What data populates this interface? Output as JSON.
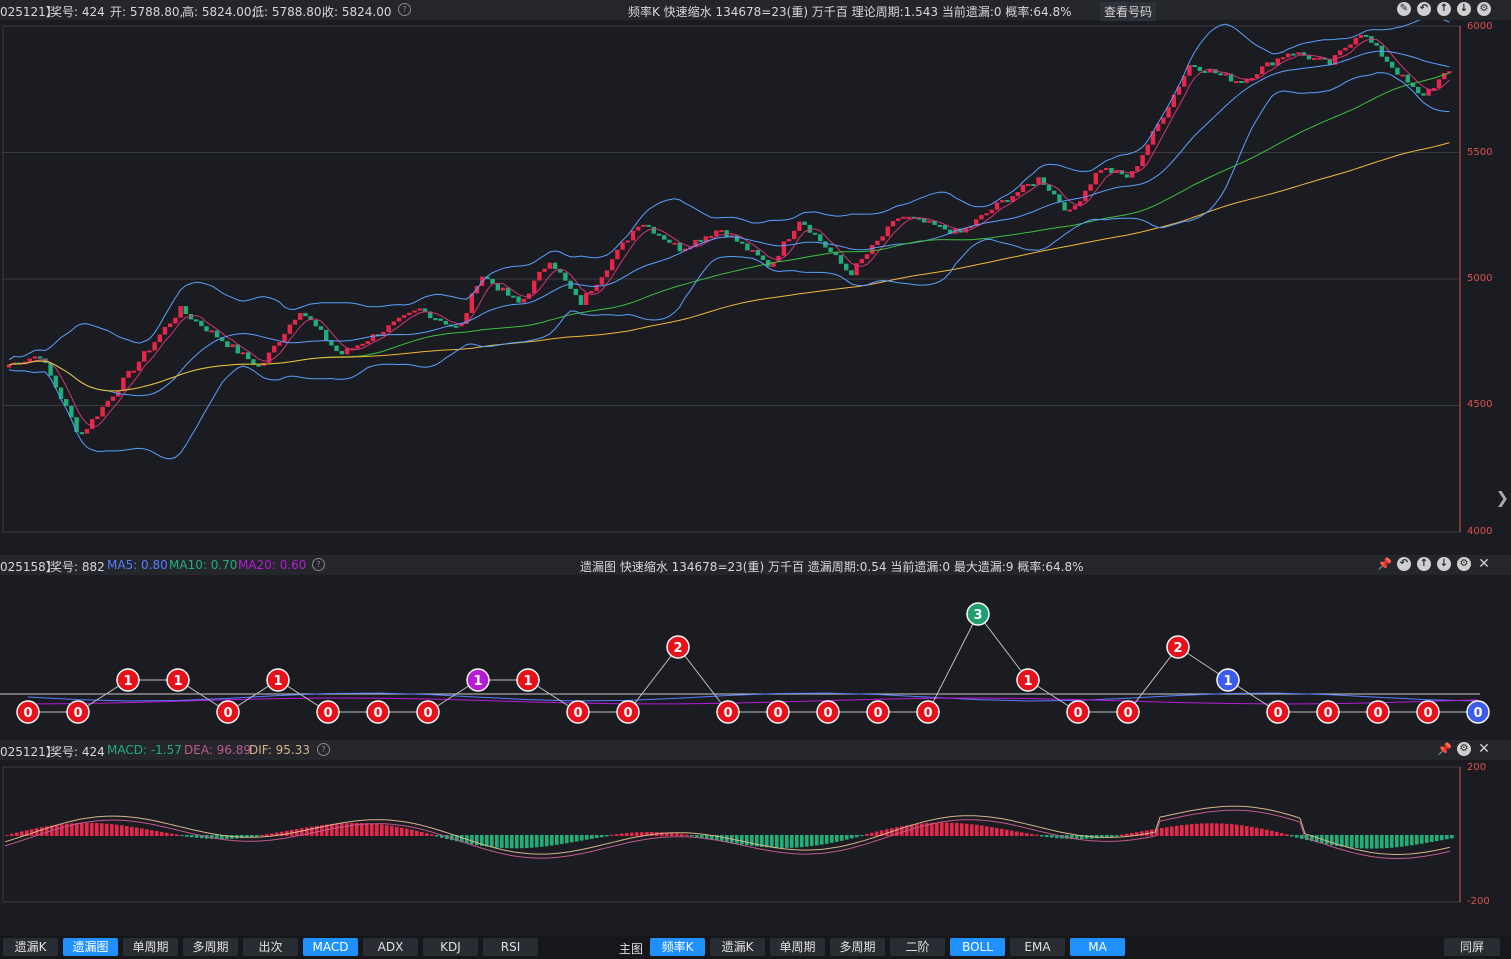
{
  "top_info": {
    "code": "025121】",
    "prize": "奖号: 424",
    "open": "开: 5788.80,",
    "high": "高: 5824.00,",
    "low": "低: 5788.80,",
    "close": "收: 5824.00",
    "center": "频率K  快速缩水   134678=23(重)  万千百  理论周期:1.543  当前遗漏:0  概率:64.8%",
    "query_label": "查看号码"
  },
  "main_axis": {
    "ticks": [
      "6000",
      "5500",
      "5000",
      "4500",
      "4000"
    ]
  },
  "mid_info": {
    "code": "025158】",
    "prize": "奖号: 882",
    "ma5": "MA5: 0.80",
    "ma10": "MA10: 0.70",
    "ma20": "MA20: 0.60",
    "center": "遗漏图  快速缩水   134678=23(重)  万千百  遗漏周期:0.54  当前遗漏:0  最大遗漏:9  概率:64.8%"
  },
  "omission_nodes": [
    0,
    0,
    1,
    1,
    0,
    1,
    0,
    0,
    0,
    1,
    1,
    0,
    0,
    2,
    0,
    0,
    0,
    0,
    0,
    3,
    1,
    0,
    0,
    2,
    1,
    0,
    0,
    0,
    0,
    0
  ],
  "node_colors": {
    "default": "#e8101a",
    "one_purple": "#b61bd6",
    "three": "#1f9e6e",
    "blue": "#3c5cf0"
  },
  "low_info": {
    "code": "025121】",
    "prize": "奖号: 424",
    "macd": "MACD: -1.57",
    "dea": "DEA: 96.89",
    "dif": "DIF: 95.33"
  },
  "macd_axis": {
    "top": "200",
    "bottom": "-200"
  },
  "bottom_left": [
    "遗漏K",
    "遗漏图",
    "单周期",
    "多周期",
    "出次",
    "MACD",
    "ADX",
    "KDJ",
    "RSI"
  ],
  "bottom_left_active": [
    "遗漏图",
    "MACD"
  ],
  "bottom_mid_label": "主图",
  "bottom_mid": [
    "频率K",
    "遗漏K",
    "单周期",
    "多周期",
    "二阶",
    "BOLL",
    "EMA",
    "MA"
  ],
  "bottom_mid_active": [
    "频率K",
    "BOLL",
    "MA"
  ],
  "fullscreen": "同屏",
  "colors": {
    "up": "#e8264c",
    "down": "#1fae7a",
    "ma_yellow": "#f0b73a",
    "ma_green": "#3cc03c",
    "boll": "#5aa0ff",
    "ma_pink": "#d0357a"
  }
}
